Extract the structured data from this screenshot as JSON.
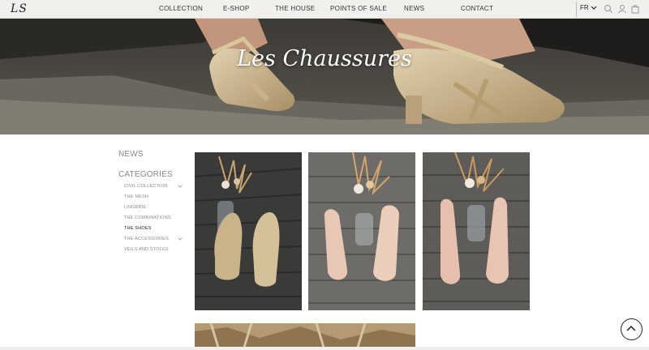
{
  "header": {
    "logo": "LS",
    "nav": [
      "COLLECTION",
      "E-SHOP",
      "THE HOUSE",
      "POINTS OF SALE",
      "NEWS",
      "CONTACT"
    ],
    "lang": "FR",
    "icons": [
      "search-icon",
      "user-icon",
      "bag-icon"
    ]
  },
  "hero": {
    "title": "Les Chaussures"
  },
  "sidebar": {
    "news": "NEWS",
    "categories_heading": "CATEGORIES",
    "categories": [
      {
        "label": "CIVIL COLLECTION",
        "expandable": true,
        "active": false
      },
      {
        "label": "THE MESH",
        "expandable": false,
        "active": false
      },
      {
        "label": "LINGERIE",
        "expandable": false,
        "active": false
      },
      {
        "label": "THE COMBINATIONS",
        "expandable": false,
        "active": false
      },
      {
        "label": "THE SHOES",
        "expandable": false,
        "active": true
      },
      {
        "label": "THE ACCESSORIES",
        "expandable": true,
        "active": false
      },
      {
        "label": "VEILS AND STOLES",
        "expandable": false,
        "active": false
      }
    ]
  },
  "products": [
    {
      "name": "gold-shoes-tile",
      "shoe_color": "#c9b48a"
    },
    {
      "name": "pink-mesh-shoes-tile",
      "shoe_color": "#e8c7b4"
    },
    {
      "name": "pink-strap-shoes-tile",
      "shoe_color": "#e6bfae"
    }
  ],
  "colors": {
    "topbar": "#f1f0ec",
    "text": "#333333",
    "muted": "#888888",
    "active": "#222222"
  }
}
